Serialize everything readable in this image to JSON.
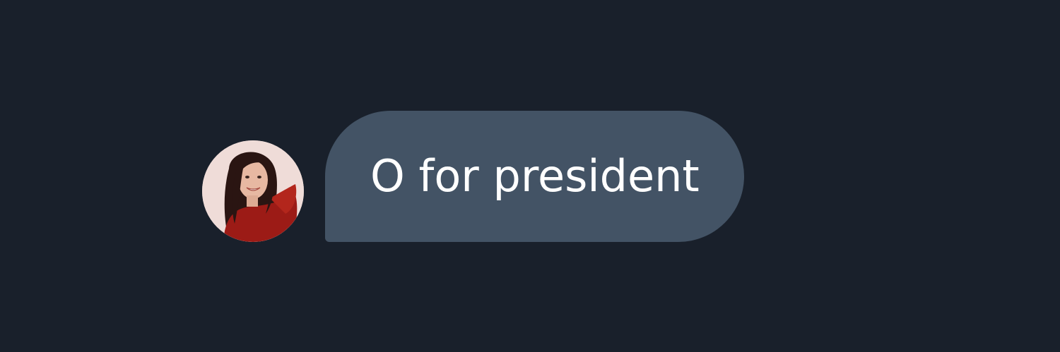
{
  "conversation": {
    "messages": [
      {
        "avatar_icon": "user-avatar-photo",
        "text": "O for president"
      }
    ]
  },
  "colors": {
    "background": "#19202b",
    "bubble": "#435365",
    "text": "#ffffff"
  }
}
